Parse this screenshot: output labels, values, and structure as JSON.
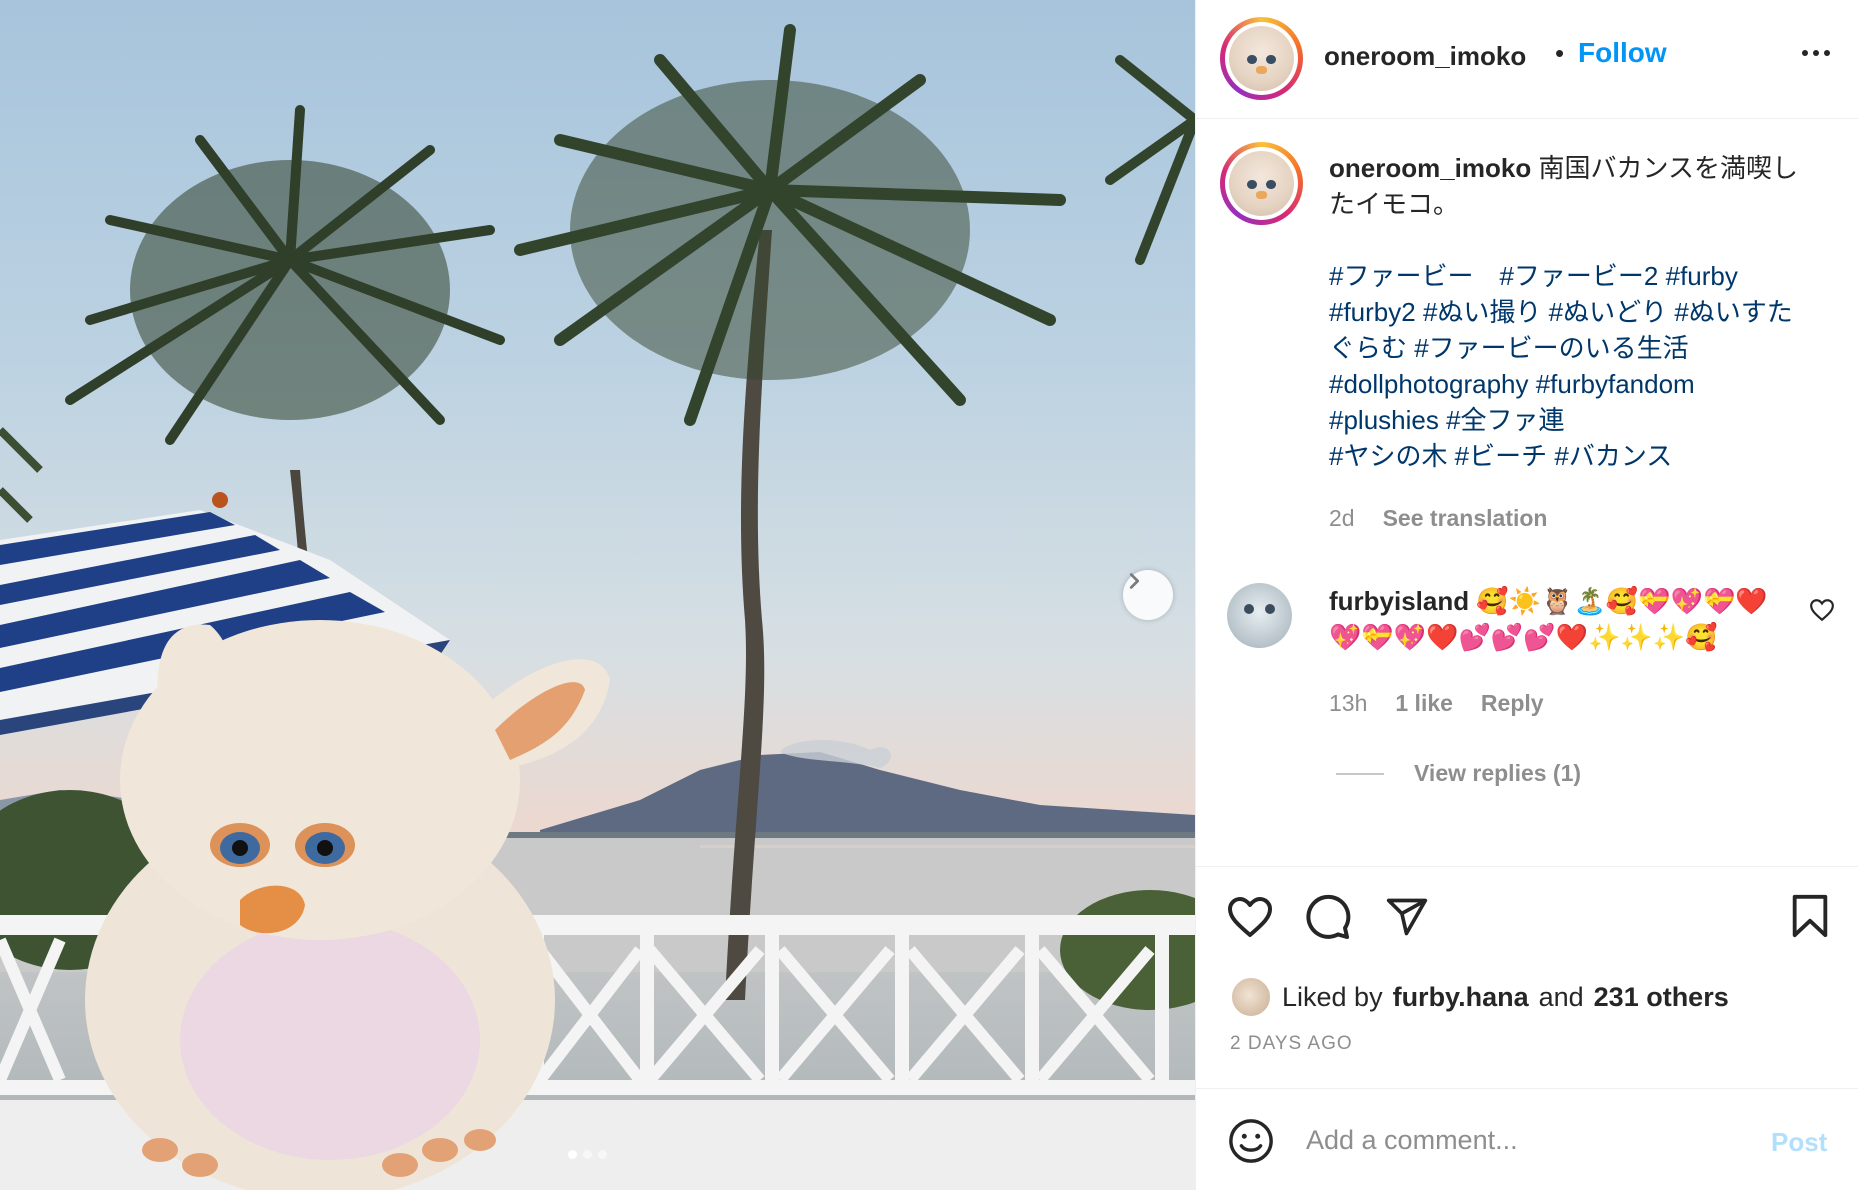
{
  "post": {
    "username": "oneroom_imoko",
    "separator": "•",
    "follow_label": "Follow",
    "image_count": 3,
    "active_image_index": 0
  },
  "caption": {
    "username": "oneroom_imoko",
    "text": "南国バカンスを満喫したイモコ。",
    "hashtags": "#ファービー　#ファービー2 #furby #furby2 #ぬい撮り #ぬいどり #ぬいすたぐらむ #ファービーのいる生活\n#dollphotography #furbyfandom\n#plushies #全ファ連\n#ヤシの木 #ビーチ #バカンス",
    "time": "2d",
    "see_translation": "See translation"
  },
  "comment": {
    "username": "furbyisland",
    "text": "🥰☀️🦉🏝️🥰💝💖💝❤️💖💝💖❤️💕💕💕❤️✨✨✨🥰",
    "time": "13h",
    "likes": "1 like",
    "reply_label": "Reply",
    "view_replies": "View replies (1)"
  },
  "likes": {
    "prefix": "Liked by",
    "user": "furby.hana",
    "middle": "and",
    "others": "231 others"
  },
  "timestamp": "2 DAYS AGO",
  "add_comment": {
    "placeholder": "Add a comment...",
    "post_label": "Post"
  },
  "icons": {
    "more": "more-options-icon",
    "like": "heart-icon",
    "comment": "comment-icon",
    "share": "share-icon",
    "save": "bookmark-icon",
    "emoji": "emoji-icon",
    "next": "chevron-right-icon"
  },
  "colors": {
    "accent": "#0095f6",
    "hashtag": "#00376b",
    "muted": "#8e8e8e",
    "post_disabled": "#b2dffc"
  }
}
